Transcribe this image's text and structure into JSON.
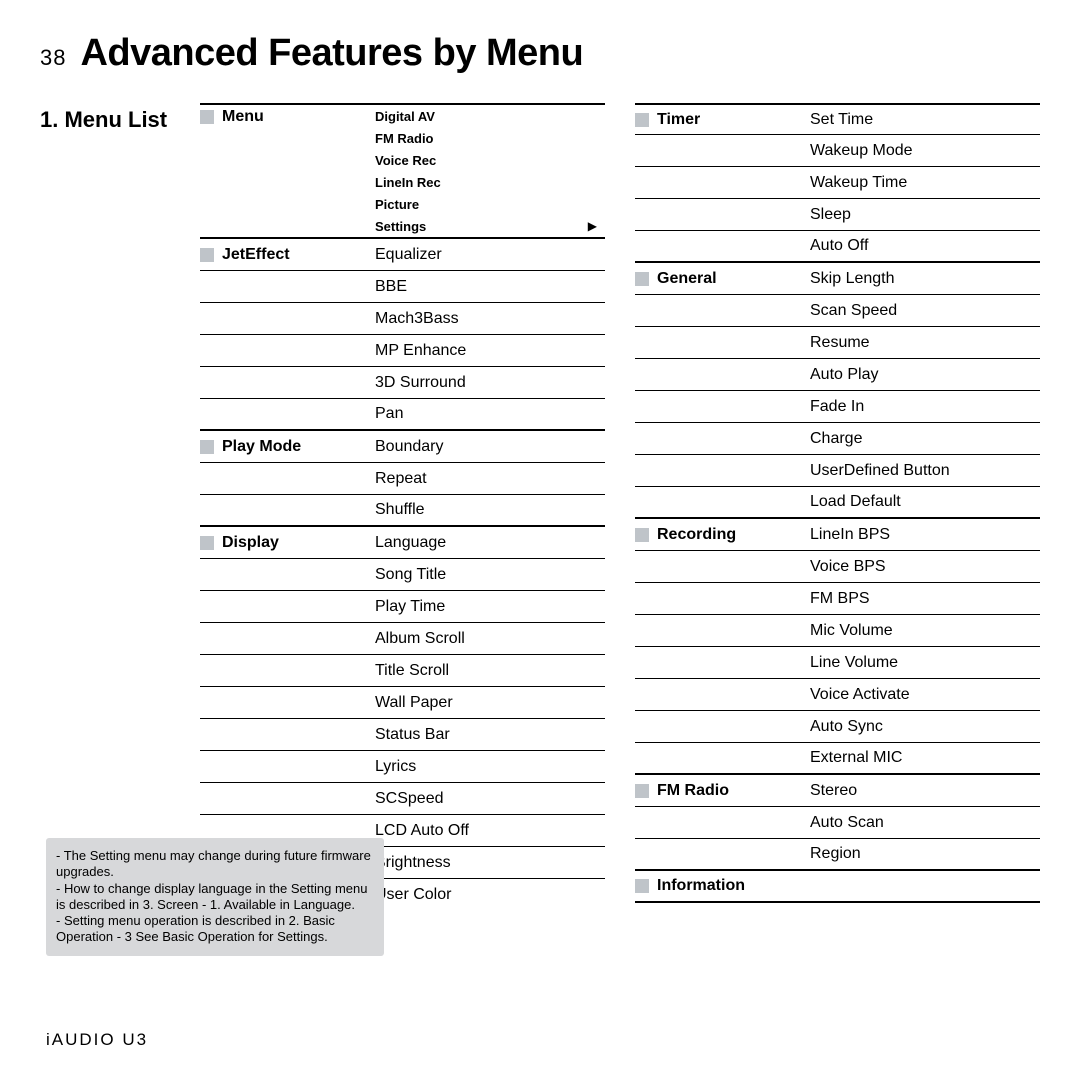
{
  "header": {
    "page_num": "38",
    "title": "Advanced Features by Menu"
  },
  "section_title": "1. Menu List",
  "col1": {
    "menu": {
      "label": "Menu",
      "items": [
        "Digital AV",
        "FM Radio",
        "Voice Rec",
        "LineIn Rec",
        "Picture",
        "Settings"
      ]
    },
    "groups": [
      {
        "label": "JetEffect",
        "items": [
          "Equalizer",
          "BBE",
          "Mach3Bass",
          "MP Enhance",
          "3D Surround",
          "Pan"
        ]
      },
      {
        "label": "Play Mode",
        "items": [
          "Boundary",
          "Repeat",
          "Shuffle"
        ]
      },
      {
        "label": "Display",
        "items": [
          "Language",
          "Song Title",
          "Play Time",
          "Album Scroll",
          "Title Scroll",
          "Wall Paper",
          "Status Bar",
          "Lyrics",
          "SCSpeed",
          "LCD Auto Off",
          "Brightness",
          "User Color"
        ]
      }
    ]
  },
  "col2": {
    "groups": [
      {
        "label": "Timer",
        "items": [
          "Set Time",
          "Wakeup Mode",
          "Wakeup Time",
          "Sleep",
          "Auto Off"
        ]
      },
      {
        "label": "General",
        "items": [
          "Skip Length",
          "Scan Speed",
          "Resume",
          "Auto Play",
          "Fade In",
          "Charge",
          "UserDefined Button",
          "Load Default"
        ]
      },
      {
        "label": "Recording",
        "items": [
          "LineIn BPS",
          "Voice BPS",
          "FM BPS",
          "Mic Volume",
          "Line Volume",
          "Voice Activate",
          "Auto Sync",
          "External MIC"
        ]
      },
      {
        "label": "FM Radio",
        "items": [
          "Stereo",
          "Auto Scan",
          "Region"
        ]
      },
      {
        "label": "Information",
        "items": []
      }
    ]
  },
  "note": {
    "l1": "- The Setting menu may change during future firmware upgrades.",
    "l2": "- How to change display language in the Setting menu is described in 3. Screen - 1. Available in Language.",
    "l3": "- Setting menu operation is described in 2. Basic Operation - 3 See Basic Operation for Settings."
  },
  "footer": "iAUDIO U3",
  "arrow": "▶"
}
